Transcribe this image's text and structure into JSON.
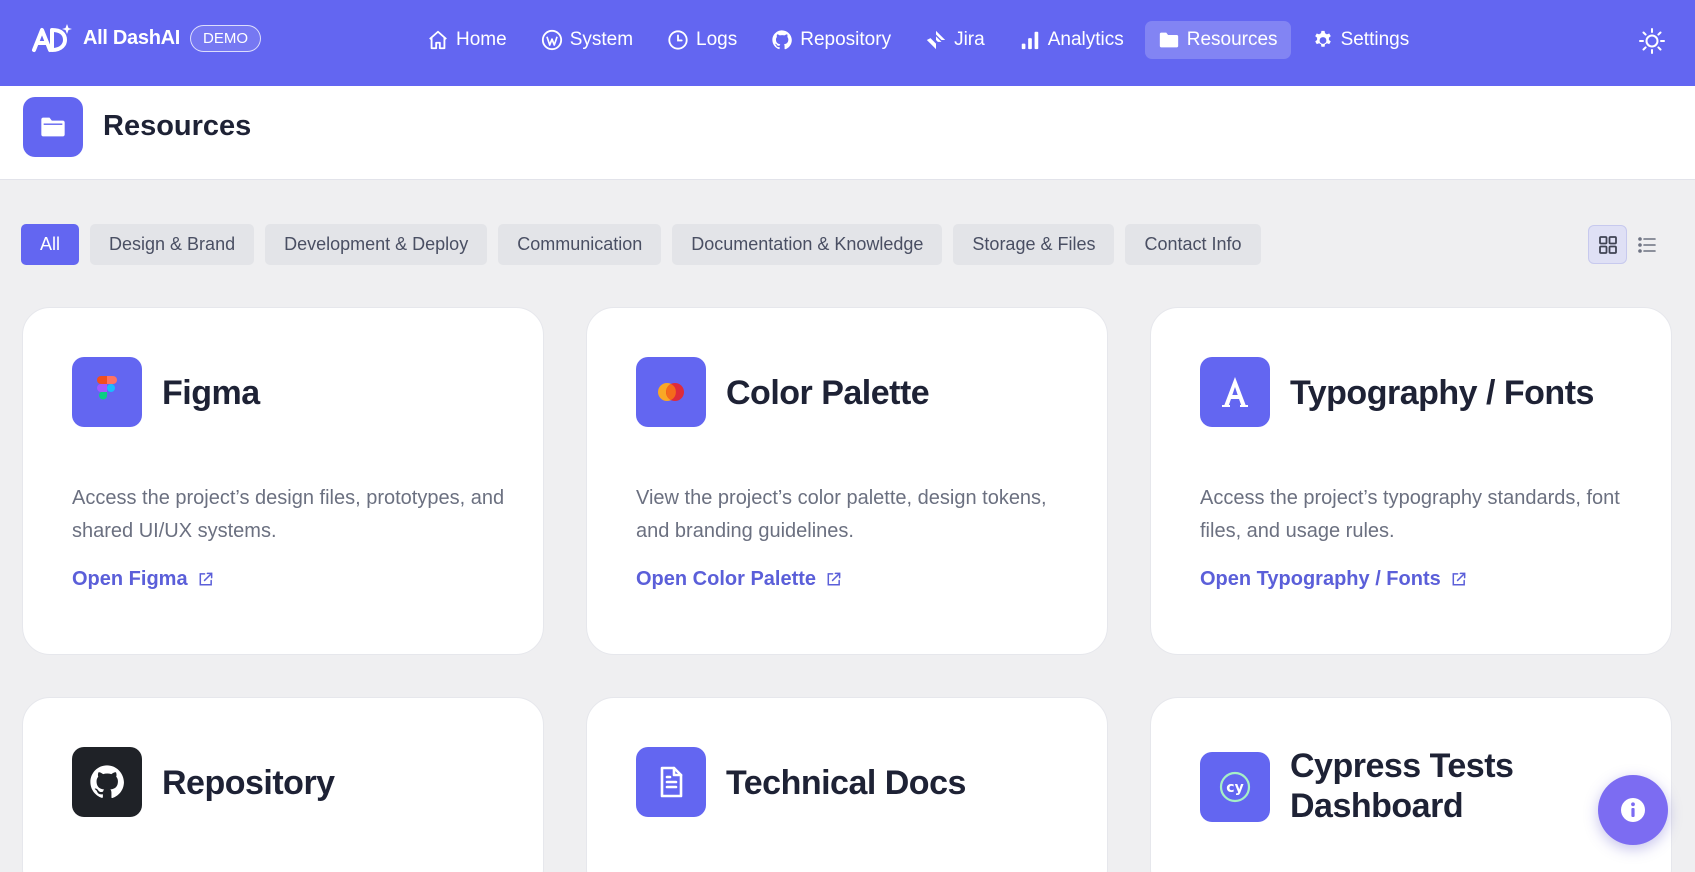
{
  "brand": {
    "name": "All DashAI",
    "badge": "DEMO"
  },
  "nav": {
    "items": [
      {
        "label": "Home",
        "icon": "home-icon"
      },
      {
        "label": "System",
        "icon": "wordpress-icon"
      },
      {
        "label": "Logs",
        "icon": "clock-icon"
      },
      {
        "label": "Repository",
        "icon": "github-icon"
      },
      {
        "label": "Jira",
        "icon": "jira-icon"
      },
      {
        "label": "Analytics",
        "icon": "bar-chart-icon"
      },
      {
        "label": "Resources",
        "icon": "folder-icon",
        "active": true
      },
      {
        "label": "Settings",
        "icon": "gear-icon"
      }
    ],
    "theme_toggle_icon": "sun-icon"
  },
  "page": {
    "title": "Resources",
    "icon": "folder-icon"
  },
  "filters": {
    "items": [
      {
        "label": "All",
        "active": true
      },
      {
        "label": "Design & Brand"
      },
      {
        "label": "Development & Deploy"
      },
      {
        "label": "Communication"
      },
      {
        "label": "Documentation & Knowledge"
      },
      {
        "label": "Storage & Files"
      },
      {
        "label": "Contact Info"
      }
    ],
    "view_modes": [
      {
        "icon": "grid-icon",
        "active": true
      },
      {
        "icon": "list-icon"
      }
    ]
  },
  "cards": [
    {
      "title": "Figma",
      "icon": "figma-icon",
      "description": "Access the project’s design files, prototypes, and shared UI/UX systems.",
      "link": "Open Figma"
    },
    {
      "title": "Color Palette",
      "icon": "color-palette-icon",
      "description": "View the project’s color palette, design tokens, and branding guidelines.",
      "link": "Open Color Palette"
    },
    {
      "title": "Typography / Fonts",
      "icon": "typography-icon",
      "description": "Access the project’s typography standards, font files, and usage rules.",
      "link": "Open Typography / Fonts"
    },
    {
      "title": "Repository",
      "icon": "github-icon"
    },
    {
      "title": "Technical Docs",
      "icon": "document-icon"
    },
    {
      "title": "Cypress Tests Dashboard",
      "icon": "cypress-icon"
    }
  ],
  "colors": {
    "accent": "#6366f1",
    "background": "#efeff1",
    "link": "#5b5fd9",
    "fab": "#7c6cf2"
  },
  "fab": {
    "icon": "info-icon"
  }
}
